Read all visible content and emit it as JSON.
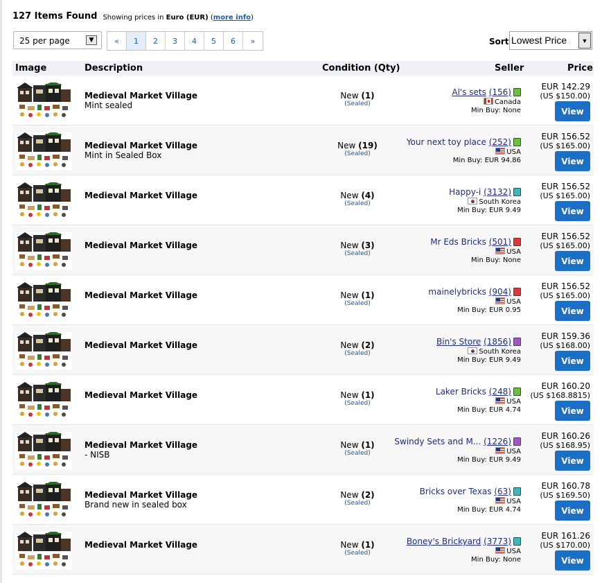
{
  "header": {
    "count": "127 Items Found",
    "showing_prefix": "Showing prices in ",
    "currency": "Euro (EUR)",
    "more_open": " (",
    "more_info": "more info",
    "more_close": ")"
  },
  "controls": {
    "per_page": "25 per page",
    "pages": [
      "«",
      "1",
      "2",
      "3",
      "4",
      "5",
      "6",
      "»"
    ],
    "active_page": "1",
    "sort_label": "Sort",
    "sort_value": "Lowest Price"
  },
  "table": {
    "headers": {
      "image": "Image",
      "description": "Description",
      "condition": "Condition (Qty)",
      "seller": "Seller",
      "price": "Price"
    },
    "view_label": "View",
    "rows": [
      {
        "name": "Medieval Market Village",
        "sub": "Mint sealed",
        "cond": "New",
        "qty": "(1)",
        "sealed": "(Sealed)",
        "seller": "Al's sets",
        "fb": "(156)",
        "country": "Canada",
        "flag": "ca",
        "minbuy": "Min Buy: None",
        "eur": "EUR 142.29",
        "usd": "(US $150.00)",
        "cube": "#6abf3f"
      },
      {
        "name": "Medieval Market Village",
        "sub": "Mint in Sealed Box",
        "cond": "New",
        "qty": "(19)",
        "sealed": "(Sealed)",
        "seller": "Your next toy place",
        "fb": "(252)",
        "country": "USA",
        "flag": "us",
        "minbuy": "Min Buy: EUR 94.86",
        "eur": "EUR 156.52",
        "usd": "(US $165.00)",
        "cube": "#6abf3f"
      },
      {
        "name": "Medieval Market Village",
        "sub": "",
        "cond": "New",
        "qty": "(4)",
        "sealed": "(Sealed)",
        "seller": "Happy-i",
        "fb": "(3132)",
        "country": "South Korea",
        "flag": "kr",
        "minbuy": "Min Buy: EUR 9.49",
        "eur": "EUR 156.52",
        "usd": "(US $165.00)",
        "cube": "#3fb6bf"
      },
      {
        "name": "Medieval Market Village",
        "sub": "",
        "cond": "New",
        "qty": "(3)",
        "sealed": "(Sealed)",
        "seller": "Mr Eds Bricks",
        "fb": "(501)",
        "country": "USA",
        "flag": "us",
        "minbuy": "Min Buy: None",
        "eur": "EUR 156.52",
        "usd": "(US $165.00)",
        "cube": "#d63a3a"
      },
      {
        "name": "Medieval Market Village",
        "sub": "",
        "cond": "New",
        "qty": "(1)",
        "sealed": "(Sealed)",
        "seller": "mainelybricks",
        "fb": "(904)",
        "country": "USA",
        "flag": "us",
        "minbuy": "Min Buy: EUR 0.95",
        "eur": "EUR 156.52",
        "usd": "(US $165.00)",
        "cube": "#d63a3a"
      },
      {
        "name": "Medieval Market Village",
        "sub": "",
        "cond": "New",
        "qty": "(2)",
        "sealed": "(Sealed)",
        "seller": "Bin's Store",
        "fb": "(1856)",
        "country": "South Korea",
        "flag": "kr",
        "minbuy": "Min Buy: EUR 9.49",
        "eur": "EUR 159.36",
        "usd": "(US $168.00)",
        "cube": "#a456c4"
      },
      {
        "name": "Medieval Market Village",
        "sub": "",
        "cond": "New",
        "qty": "(1)",
        "sealed": "(Sealed)",
        "seller": "Laker Bricks",
        "fb": "(248)",
        "country": "USA",
        "flag": "us",
        "minbuy": "Min Buy: EUR 4.74",
        "eur": "EUR 160.20",
        "usd": "(US $168.8815)",
        "cube": "#6abf3f"
      },
      {
        "name": "Medieval Market Village",
        "sub": "- NISB",
        "cond": "New",
        "qty": "(1)",
        "sealed": "(Sealed)",
        "seller": "Swindy Sets and M...",
        "fb": "(1226)",
        "country": "USA",
        "flag": "us",
        "minbuy": "Min Buy: EUR 9.49",
        "eur": "EUR 160.26",
        "usd": "(US $168.95)",
        "cube": "#a456c4"
      },
      {
        "name": "Medieval Market Village",
        "sub": "Brand new in sealed box",
        "cond": "New",
        "qty": "(2)",
        "sealed": "(Sealed)",
        "seller": "Bricks over Texas",
        "fb": "(63)",
        "country": "USA",
        "flag": "us",
        "minbuy": "Min Buy: EUR 4.74",
        "eur": "EUR 160.78",
        "usd": "(US $169.50)",
        "cube": "#3fb6bf"
      },
      {
        "name": "Medieval Market Village",
        "sub": "",
        "cond": "New",
        "qty": "(1)",
        "sealed": "(Sealed)",
        "seller": "Boney's Brickyard",
        "fb": "(3773)",
        "country": "USA",
        "flag": "us",
        "minbuy": "Min Buy: None",
        "eur": "EUR 161.26",
        "usd": "(US $170.00)",
        "cube": "#3fb6bf"
      }
    ]
  }
}
